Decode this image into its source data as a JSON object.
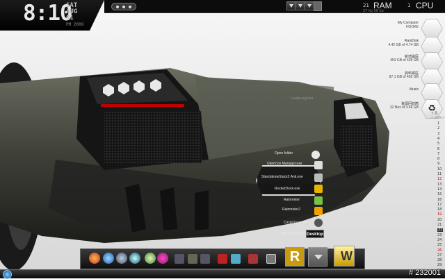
{
  "clock": {
    "time": "8:10",
    "day": "SAT",
    "month": "AUG",
    "date": "01",
    "ampm": "PM 2009"
  },
  "meters": {
    "disk_number": "21",
    "disk_sub": "27 kb  50 kb",
    "ram_label": "RAM",
    "cpu_number": "1",
    "cpu_label": "CPU"
  },
  "drives": [
    {
      "title": "My Computer",
      "subtitle": "HOOKE"
    },
    {
      "title": "RamDisk",
      "subtitle": "4.42 GB of 4.74 GB"
    },
    {
      "title": "新增磁區",
      "subtitle": "453 GB of 439 GB"
    },
    {
      "title": "資料磁區",
      "subtitle": "87.1 GB of 465 GB"
    },
    {
      "title": "Music",
      "subtitle": ""
    },
    {
      "title": "資源回收筒",
      "subtitle": "32 files of 3.46 GB"
    }
  ],
  "calendar": {
    "month": "7 月",
    "year": "< 2009 >",
    "days": [
      "1",
      "2",
      "3",
      "4",
      "5",
      "6",
      "7",
      "8",
      "9",
      "10",
      "11",
      "12",
      "13",
      "14",
      "15",
      "16",
      "17",
      "18",
      "19",
      "20",
      "21",
      "22",
      "23",
      "24",
      "25",
      "26",
      "27",
      "28",
      "29",
      "30",
      "31"
    ],
    "red_days": [
      "12",
      "19",
      "26"
    ],
    "today": "22"
  },
  "launcher": {
    "items": [
      "Open folder",
      "UberIcon Manager.exe",
      "StandaloneStack2 Anti.exe",
      "RocketDock.exe",
      "Rainmeter",
      "Rainmeter2",
      "CircleDock.exe",
      "AVEDESK.EXE"
    ],
    "desktop_label": "Desktop"
  },
  "dock": {
    "tile_r_label": "R",
    "tile_w_label": "W"
  },
  "watermark": "# 232001",
  "colors": {
    "panel_dark": "#0c0c0c",
    "car_body": "#3e4038",
    "accent_red": "#c00000"
  }
}
